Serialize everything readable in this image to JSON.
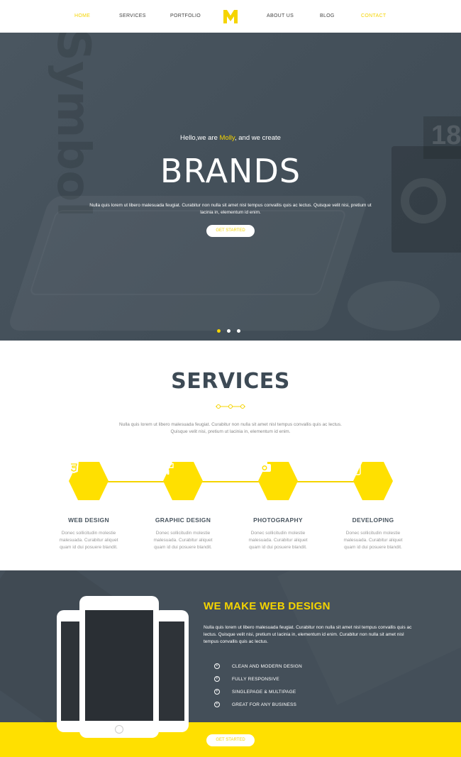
{
  "nav": {
    "items": [
      "HOME",
      "SERVICES",
      "PORTFOLIO",
      "ABOUT US",
      "BLOG",
      "CONTACT"
    ]
  },
  "hero": {
    "intro_pre": "Hello,we are ",
    "intro_name": "Molly",
    "intro_post": ", and we create",
    "title": "BRANDS",
    "description": "Nulla quis lorem ut libero malesuada feugiat. Curabitur non nulla sit amet nisl tempus convallis quis ac lectus. Quisque velit nisi, pretium ut lacinia in, elementum id enim.",
    "button": "GET STARTED",
    "bg_text": "Symbol",
    "bg_number": "18"
  },
  "services": {
    "title": "SERVICES",
    "description": "Nulla quis lorem ut libero malesuada feugiat. Curabitur non nulla sit amet nisl tempus convallis quis ac lectus. Quisque velit nisi, pretium ut lacinia in, elementum id enim.",
    "items": [
      {
        "title": "WEB DESIGN",
        "icon": "css3-icon",
        "text": "Donec sollicitudin molestie malesuada. Curabitur aliquet quam id dui posuere blandit."
      },
      {
        "title": "GRAPHIC DESIGN",
        "icon": "paint-roller-icon",
        "text": "Donec sollicitudin molestie malesuada. Curabitur aliquet quam id dui posuere blandit."
      },
      {
        "title": "PHOTOGRAPHY",
        "icon": "camera-icon",
        "text": "Donec sollicitudin molestie malesuada. Curabitur aliquet quam id dui posuere blandit."
      },
      {
        "title": "DEVELOPING",
        "icon": "mobile-icon",
        "text": "Donec sollicitudin molestie malesuada. Curabitur aliquet quam id dui posuere blandit."
      }
    ]
  },
  "webdesign": {
    "title": "WE MAKE WEB DESIGN",
    "description": "Nulla quis lorem ut libero malesuada feugiat. Curabitur non nulla sit amet nisl tempus convallis quis ac lectus. Quisque velit nisi, pretium ut lacinia in, elementum id enim. Curabitur non nulla sit amet nisl tempus convallis quis ac lectus.",
    "features": [
      "CLEAN AND MODERN DESIGN",
      "FULLY RESPONSIVE",
      "SINGLEPAGE & MULTIPAGE",
      "GREAT FOR ANY BUSINESS"
    ],
    "button": "GET STARTED"
  },
  "colors": {
    "accent": "#f5d400",
    "dark": "#444f59",
    "heading": "#3d4a55"
  }
}
